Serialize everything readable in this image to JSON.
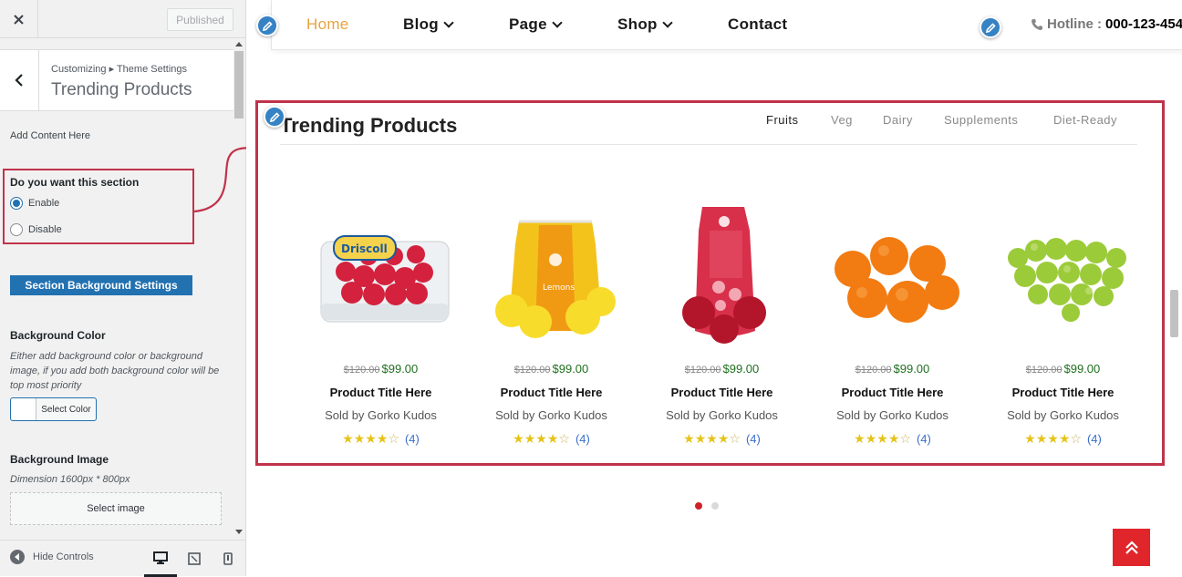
{
  "sidebar": {
    "close_icon": "close-icon",
    "published_label": "Published",
    "breadcrumb": "Customizing ▸ Theme Settings",
    "panel_title": "Trending Products",
    "add_content_label": "Add Content Here",
    "section_question": "Do you want this section",
    "options": [
      {
        "label": "Enable",
        "selected": true
      },
      {
        "label": "Disable",
        "selected": false
      }
    ],
    "bg_settings_label": "Section Background Settings",
    "bg_color_heading": "Background Color",
    "bg_color_desc": "Either add background color or background image, if you add both background color will be top most priority",
    "select_color_label": "Select Color",
    "bg_image_heading": "Background Image",
    "dimension_text": "Dimension 1600px * 800px",
    "select_image_label": "Select image",
    "hide_controls_label": "Hide Controls",
    "devices": [
      "desktop",
      "tablet",
      "mobile"
    ]
  },
  "nav": {
    "items": [
      {
        "label": "Home",
        "dropdown": false
      },
      {
        "label": "Blog",
        "dropdown": true
      },
      {
        "label": "Page",
        "dropdown": true
      },
      {
        "label": "Shop",
        "dropdown": true
      },
      {
        "label": "Contact",
        "dropdown": false
      }
    ],
    "hotline_label": "Hotline :",
    "hotline_number": "000-123-454"
  },
  "trending": {
    "title": "Trending Products",
    "tabs": [
      "Fruits",
      "Veg",
      "Dairy",
      "Supplements",
      "Diet-Ready"
    ],
    "active_tab": "Fruits",
    "products": [
      {
        "image": "raspberries",
        "old_price": "$120.00",
        "price": "$99.00",
        "title": "Product Title Here",
        "seller": "Sold by Gorko Kudos",
        "rating": 4,
        "reviews": "(4)"
      },
      {
        "image": "lemons",
        "old_price": "$120.00",
        "price": "$99.00",
        "title": "Product Title Here",
        "seller": "Sold by Gorko Kudos",
        "rating": 4,
        "reviews": "(4)"
      },
      {
        "image": "apples",
        "old_price": "$120.00",
        "price": "$99.00",
        "title": "Product Title Here",
        "seller": "Sold by Gorko Kudos",
        "rating": 4,
        "reviews": "(4)"
      },
      {
        "image": "oranges",
        "old_price": "$120.00",
        "price": "$99.00",
        "title": "Product Title Here",
        "seller": "Sold by Gorko Kudos",
        "rating": 4,
        "reviews": "(4)"
      },
      {
        "image": "grapes",
        "old_price": "$120.00",
        "price": "$99.00",
        "title": "Product Title Here",
        "seller": "Sold by Gorko Kudos",
        "rating": 4,
        "reviews": "(4)"
      }
    ],
    "pagination": {
      "pages": 2,
      "active": 1
    }
  },
  "colors": {
    "accent": "#e8a33d",
    "highlight_border": "#c0334a",
    "wp_blue": "#2271b1",
    "price_green": "#1f6f1f",
    "to_top_red": "#e0262b"
  }
}
